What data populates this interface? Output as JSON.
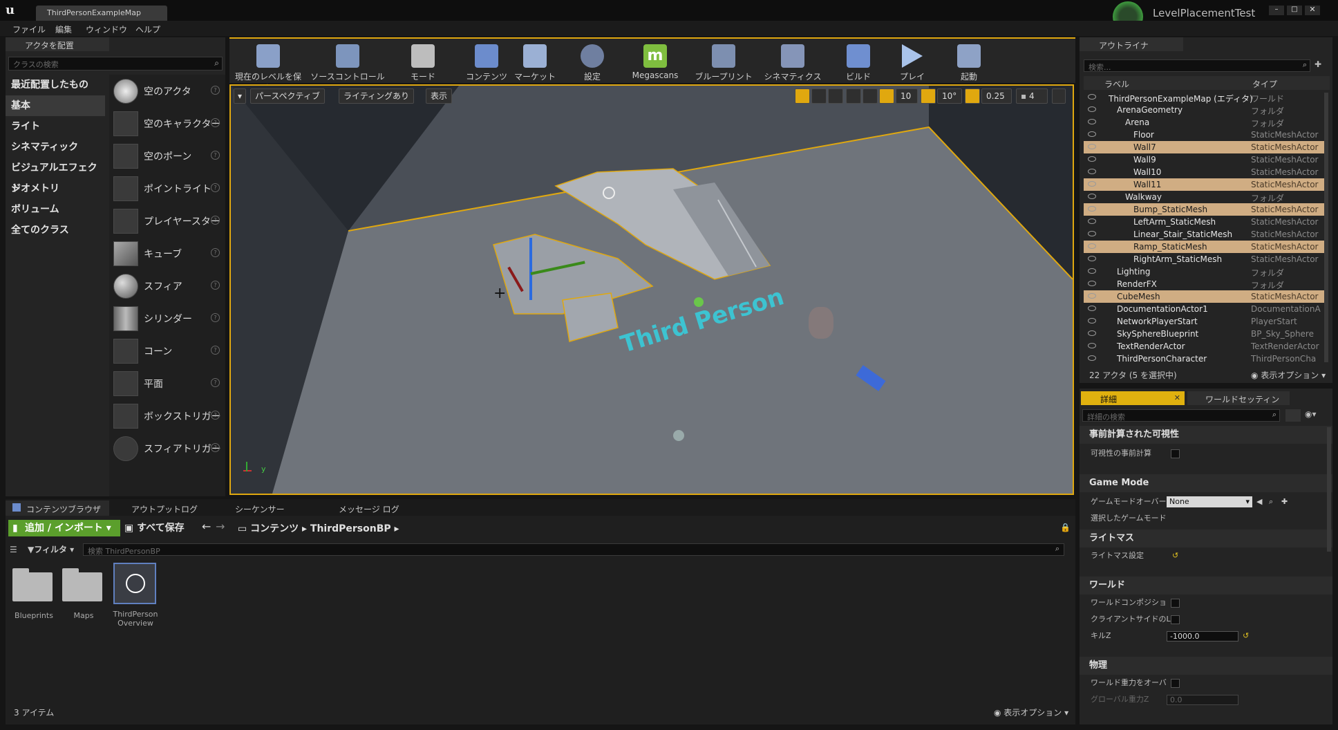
{
  "window": {
    "doc_tab": "ThirdPersonExampleMap",
    "project": "LevelPlacementTest",
    "logo": "u"
  },
  "menu": [
    "ファイル",
    "編集",
    "ウィンドウ",
    "ヘルプ"
  ],
  "place_panel": {
    "tab": "アクタを配置",
    "search_placeholder": "クラスの検索",
    "categories": [
      "最近配置したもの",
      "基本",
      "ライト",
      "シネマティック",
      "ビジュアルエフェクト",
      "ジオメトリ",
      "ボリューム",
      "全てのクラス"
    ],
    "selected_category": "基本",
    "items": [
      "空のアクタ",
      "空のキャラクター",
      "空のポーン",
      "ポイントライト",
      "プレイヤースター",
      "キューブ",
      "スフィア",
      "シリンダー",
      "コーン",
      "平面",
      "ボックストリガー",
      "スフィアトリガー"
    ]
  },
  "toolbar": [
    {
      "label": "現在のレベルを保存",
      "icon": "save-icon"
    },
    {
      "label": "ソースコントロール",
      "icon": "source-control-icon"
    },
    {
      "label": "モード",
      "icon": "modes-icon"
    },
    {
      "label": "コンテンツ",
      "icon": "content-icon"
    },
    {
      "label": "マーケット",
      "icon": "marketplace-icon"
    },
    {
      "label": "設定",
      "icon": "settings-icon"
    },
    {
      "label": "Megascans",
      "icon": "megascans-icon"
    },
    {
      "label": "ブループリント",
      "icon": "blueprint-icon"
    },
    {
      "label": "シネマティクス",
      "icon": "cinematics-icon"
    },
    {
      "label": "ビルド",
      "icon": "build-icon"
    },
    {
      "label": "プレイ",
      "icon": "play-icon"
    },
    {
      "label": "起動",
      "icon": "launch-icon"
    }
  ],
  "viewport": {
    "perspective": "パースペクティブ",
    "lighting": "ライティングあり",
    "show": "表示",
    "grid_snap": "10",
    "rot_snap": "10°",
    "scale_snap": "0.25",
    "cam_speed": "4",
    "text_actor": "Third Person",
    "axis_y": "y"
  },
  "outliner": {
    "tab": "アウトライナ",
    "search_placeholder": "検索...",
    "col_label": "ラベル",
    "col_type": "タイプ",
    "rows": [
      {
        "name": "ThirdPersonExampleMap (エディタ)",
        "type": "ワールド",
        "indent": 0,
        "sel": false
      },
      {
        "name": "ArenaGeometry",
        "type": "フォルダ",
        "indent": 1,
        "sel": false
      },
      {
        "name": "Arena",
        "type": "フォルダ",
        "indent": 2,
        "sel": false
      },
      {
        "name": "Floor",
        "type": "StaticMeshActor",
        "indent": 3,
        "sel": false
      },
      {
        "name": "Wall7",
        "type": "StaticMeshActor",
        "indent": 3,
        "sel": true
      },
      {
        "name": "Wall9",
        "type": "StaticMeshActor",
        "indent": 3,
        "sel": false
      },
      {
        "name": "Wall10",
        "type": "StaticMeshActor",
        "indent": 3,
        "sel": false
      },
      {
        "name": "Wall11",
        "type": "StaticMeshActor",
        "indent": 3,
        "sel": true
      },
      {
        "name": "Walkway",
        "type": "フォルダ",
        "indent": 2,
        "sel": false
      },
      {
        "name": "Bump_StaticMesh",
        "type": "StaticMeshActor",
        "indent": 3,
        "sel": true
      },
      {
        "name": "LeftArm_StaticMesh",
        "type": "StaticMeshActor",
        "indent": 3,
        "sel": false
      },
      {
        "name": "Linear_Stair_StaticMesh",
        "type": "StaticMeshActor",
        "indent": 3,
        "sel": false
      },
      {
        "name": "Ramp_StaticMesh",
        "type": "StaticMeshActor",
        "indent": 3,
        "sel": true
      },
      {
        "name": "RightArm_StaticMesh",
        "type": "StaticMeshActor",
        "indent": 3,
        "sel": false
      },
      {
        "name": "Lighting",
        "type": "フォルダ",
        "indent": 1,
        "sel": false
      },
      {
        "name": "RenderFX",
        "type": "フォルダ",
        "indent": 1,
        "sel": false
      },
      {
        "name": "CubeMesh",
        "type": "StaticMeshActor",
        "indent": 1,
        "sel": true
      },
      {
        "name": "DocumentationActor1",
        "type": "DocumentationA",
        "indent": 1,
        "sel": false
      },
      {
        "name": "NetworkPlayerStart",
        "type": "PlayerStart",
        "indent": 1,
        "sel": false
      },
      {
        "name": "SkySphereBlueprint",
        "type": "BP_Sky_Sphere",
        "indent": 1,
        "sel": false
      },
      {
        "name": "TextRenderActor",
        "type": "TextRenderActor",
        "indent": 1,
        "sel": false
      },
      {
        "name": "ThirdPersonCharacter",
        "type": "ThirdPersonCha",
        "indent": 1,
        "sel": false
      }
    ],
    "footer": "22 アクタ (5 を選択中)",
    "view_options": "表示オプション"
  },
  "details": {
    "tab": "詳細",
    "tab2": "ワールドセッティン",
    "search_placeholder": "詳細の検索",
    "sections": {
      "precomputed": "事前計算された可視性",
      "precompute_label": "可視性の事前計算",
      "game_mode": "Game Mode",
      "gm_override": "ゲームモードオーバー",
      "gm_value": "None",
      "selected_gm": "選択したゲームモード",
      "lightmass": "ライトマス",
      "lightmass_settings": "ライトマス設定",
      "world": "ワールド",
      "world_comp": "ワールドコンポジショ",
      "client_side": "クライアントサイドのL",
      "kill_z": "キルZ",
      "kill_z_value": "-1000.0",
      "physics": "物理",
      "override_gravity": "ワールド重力をオーバ",
      "global_gravity": "グローバル重力Z",
      "global_gravity_value": "0.0"
    }
  },
  "bottom": {
    "tabs": [
      "コンテンツブラウザ",
      "アウトプットログ",
      "シーケンサー",
      "メッセージ ログ"
    ],
    "add_import": "追加 / インポート",
    "save_all": "すべて保存",
    "path": [
      "コンテンツ",
      "ThirdPersonBP"
    ],
    "filter": "フィルタ",
    "search_placeholder": "検索 ThirdPersonBP",
    "assets": [
      "Blueprints",
      "Maps",
      "ThirdPerson Overview"
    ],
    "count": "3 アイテム",
    "view_options": "表示オプション"
  },
  "colors": {
    "accent": "#7fbe3f",
    "selection": "#d0ad83",
    "viewport_bg": "#6f747b",
    "toolbar_border": "#e0a80f",
    "details_tab": "#e0b10f"
  }
}
